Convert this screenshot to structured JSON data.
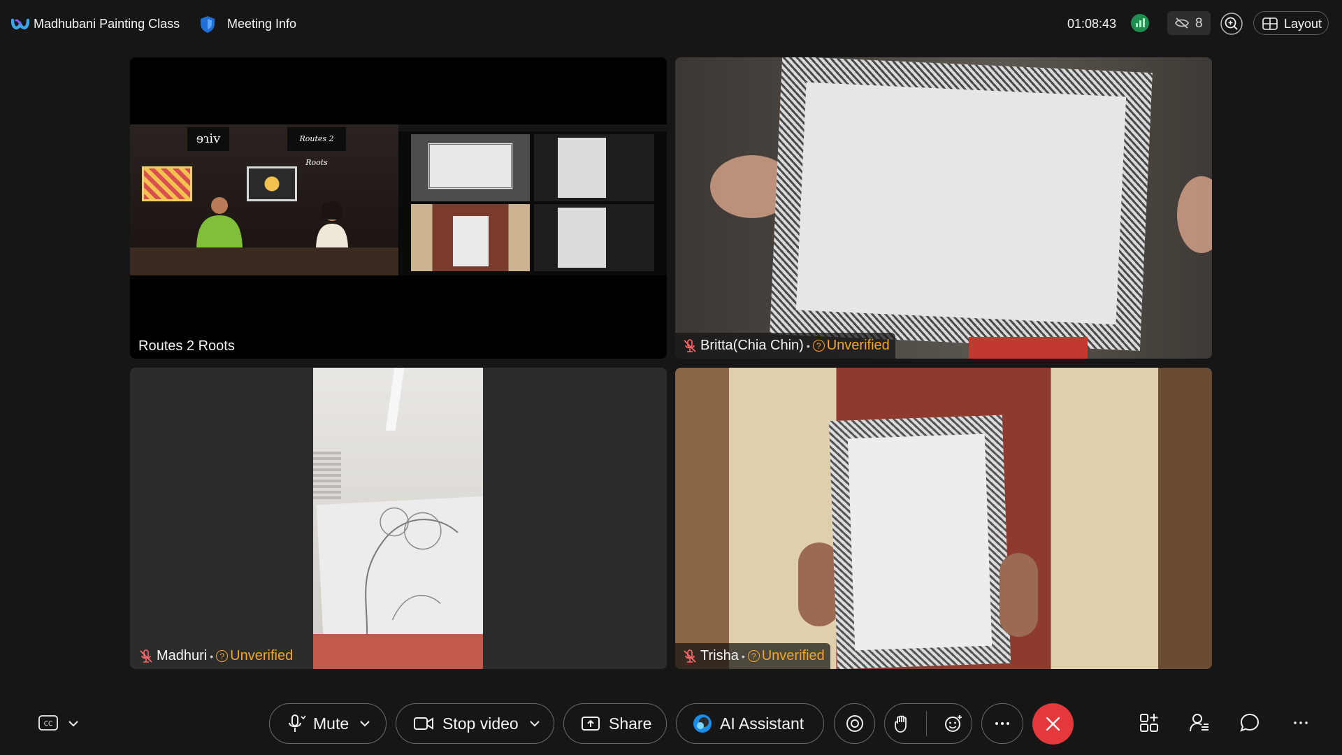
{
  "header": {
    "meeting_title": "Madhubani Painting Class",
    "meeting_info": "Meeting Info",
    "timer": "01:08:43",
    "hidden_participants": "8",
    "layout_label": "Layout"
  },
  "tiles": [
    {
      "name": "Routes 2 Roots",
      "screen_text": {
        "sign_left": "ɘɿiv",
        "sign_right": "Routes 2 Roots"
      }
    },
    {
      "name": "Britta(Chia Chin)",
      "status": "Unverified",
      "muted": true
    },
    {
      "name": "Madhuri",
      "status": "Unverified",
      "muted": true
    },
    {
      "name": "Trisha",
      "status": "Unverified",
      "muted": true
    }
  ],
  "controls": {
    "mute_label": "Mute",
    "video_label": "Stop video",
    "share_label": "Share",
    "ai_label": "AI Assistant"
  },
  "colors": {
    "background": "#161616",
    "unverified": "#f5a524",
    "leave": "#e5383b",
    "network_ok": "#1e8f4e"
  },
  "icons": [
    "webex-logo-icon",
    "shield-icon",
    "network-status-icon",
    "eye-off-icon",
    "zoom-icon",
    "layout-icon",
    "mic-off-icon",
    "unverified-icon",
    "closed-caption-icon",
    "chevron-down-icon",
    "mic-icon",
    "video-camera-icon",
    "share-screen-icon",
    "ai-assistant-icon",
    "record-icon",
    "raise-hand-icon",
    "reactions-icon",
    "more-icon",
    "close-icon",
    "apps-icon",
    "participants-icon",
    "chat-icon"
  ]
}
